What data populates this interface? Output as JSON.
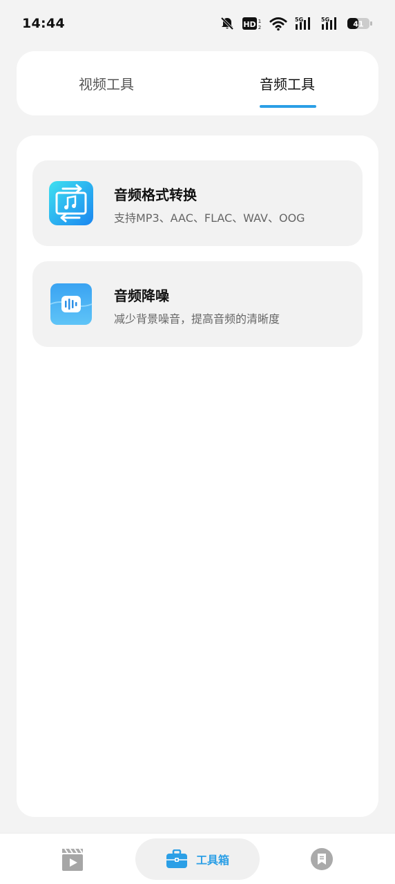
{
  "status": {
    "time": "14:44",
    "battery": "41",
    "network": [
      "5G",
      "5G"
    ],
    "hd": "HD"
  },
  "tabs": [
    {
      "label": "视频工具",
      "selected": false
    },
    {
      "label": "音频工具",
      "selected": true
    }
  ],
  "tools": [
    {
      "title": "音频格式转换",
      "description": "支持MP3、AAC、FLAC、WAV、OOG",
      "icon": "audio-convert-icon"
    },
    {
      "title": "音频降噪",
      "description": "减少背景噪音，提高音频的清晰度",
      "icon": "noise-reduction-icon"
    }
  ],
  "bottom_nav": {
    "items": [
      {
        "icon": "video-clapper-icon"
      },
      {
        "label": "工具箱",
        "icon": "toolbox-icon",
        "selected": true
      },
      {
        "icon": "message-icon"
      }
    ]
  },
  "colors": {
    "accent": "#2b9fe6",
    "background": "#f3f3f3",
    "card": "#ffffff",
    "item": "#f2f2f2"
  }
}
